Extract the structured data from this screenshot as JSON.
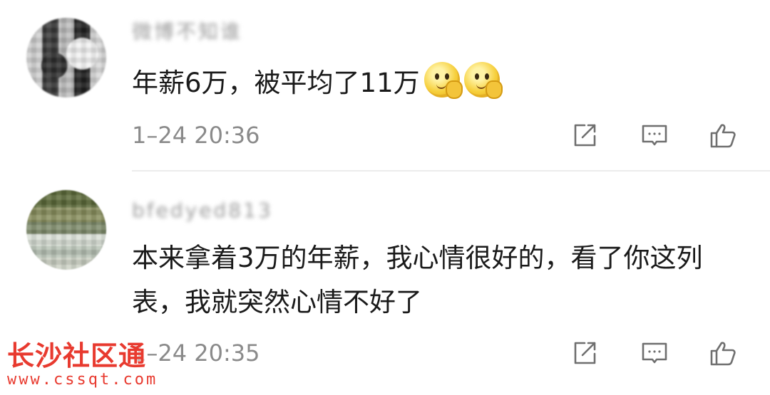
{
  "comments": [
    {
      "username": "微博不知谁",
      "text": "年薪6万，被平均了11万",
      "emoji": [
        "thinking-face-icon",
        "thinking-face-icon"
      ],
      "time": "1–24 20:36"
    },
    {
      "username": "bfedyed813",
      "text": "本来拿着3万的年薪，我心情很好的，看了你这列表，我就突然心情不好了",
      "time": "1–24 20:35"
    }
  ],
  "actions": {
    "share_icon": "share-icon",
    "reply_icon": "comment-icon",
    "like_icon": "thumbs-up-icon"
  },
  "watermark": {
    "title": "长沙社区通",
    "url": "www.cssqt.com"
  },
  "colors": {
    "text": "#1a1a1a",
    "meta": "#8a8a8a",
    "watermark": "#e83a2f",
    "divider": "#ececec"
  }
}
